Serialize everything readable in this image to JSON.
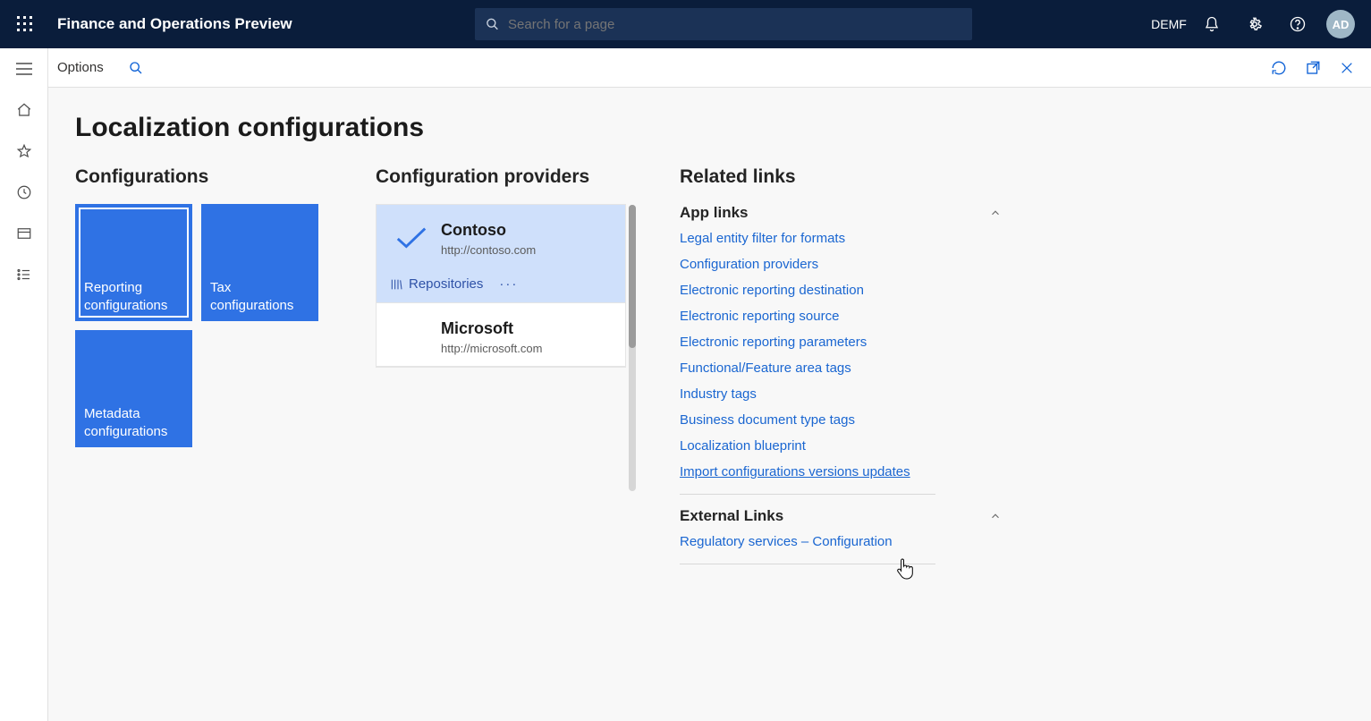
{
  "header": {
    "app_title": "Finance and Operations Preview",
    "search_placeholder": "Search for a page",
    "company": "DEMF",
    "avatar_initials": "AD"
  },
  "subheader": {
    "options_label": "Options"
  },
  "page": {
    "title": "Localization configurations"
  },
  "configurations": {
    "section_title": "Configurations",
    "tiles": [
      {
        "label": "Reporting configurations",
        "selected": true
      },
      {
        "label": "Tax configurations",
        "selected": false
      },
      {
        "label": "Metadata configurations",
        "selected": false
      }
    ]
  },
  "providers": {
    "section_title": "Configuration providers",
    "repo_label": "Repositories",
    "items": [
      {
        "name": "Contoso",
        "url": "http://contoso.com",
        "active": true
      },
      {
        "name": "Microsoft",
        "url": "http://microsoft.com",
        "active": false
      }
    ]
  },
  "related": {
    "section_title": "Related links",
    "app_links_header": "App links",
    "app_links": [
      "Legal entity filter for formats",
      "Configuration providers",
      "Electronic reporting destination",
      "Electronic reporting source",
      "Electronic reporting parameters",
      "Functional/Feature area tags",
      "Industry tags",
      "Business document type tags",
      "Localization blueprint",
      "Import configurations versions updates"
    ],
    "external_links_header": "External Links",
    "external_links": [
      "Regulatory services – Configuration"
    ]
  }
}
